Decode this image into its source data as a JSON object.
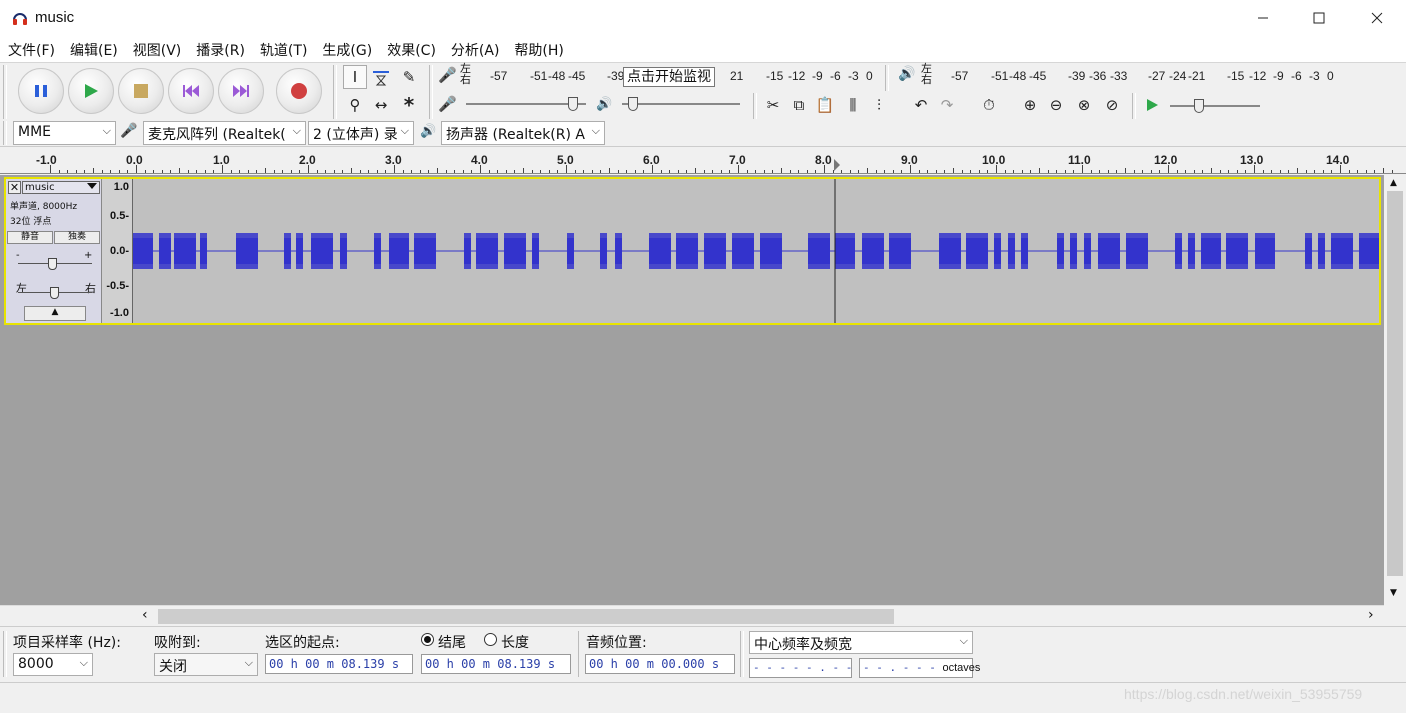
{
  "window": {
    "title": "music"
  },
  "menu": [
    "文件(F)",
    "编辑(E)",
    "视图(V)",
    "播录(R)",
    "轨道(T)",
    "生成(G)",
    "效果(C)",
    "分析(A)",
    "帮助(H)"
  ],
  "meters": {
    "rec_lr": [
      "左",
      "右"
    ],
    "rec_scale": [
      "-57",
      "-51",
      "-48",
      "-45",
      "-39",
      "21",
      "-15",
      "-12",
      "-9",
      "-6",
      "-3",
      "0"
    ],
    "monitor_tooltip": "点击开始监视",
    "play_lr": [
      "左",
      "右"
    ],
    "play_scale": [
      "-57",
      "-51",
      "-48",
      "-45",
      "-39",
      "-36",
      "-33",
      "-27",
      "-24",
      "-21",
      "-15",
      "-12",
      "-9",
      "-6",
      "-3",
      "0"
    ]
  },
  "device": {
    "host": "MME",
    "input": "麦克风阵列 (Realtek(",
    "channels": "2 (立体声) 录",
    "output": "扬声器 (Realtek(R) A"
  },
  "ruler": {
    "labels": [
      "-1.0",
      "0.0",
      "1.0",
      "2.0",
      "3.0",
      "4.0",
      "5.0",
      "6.0",
      "7.0",
      "8.0",
      "9.0",
      "10.0",
      "11.0",
      "12.0",
      "13.0",
      "14.0"
    ]
  },
  "track": {
    "name": "music",
    "info1": "单声道, 8000Hz",
    "info2": "32位 浮点",
    "mute": "静音",
    "solo": "独奏",
    "gain_minus": "-",
    "gain_plus": "+",
    "pan_left": "左",
    "pan_right": "右",
    "vscale": [
      "1.0",
      "0.5-",
      "0.0-",
      "-0.5-",
      "-1.0"
    ],
    "cursor_time_s": 8.139
  },
  "selection": {
    "rate_label": "项目采样率 (Hz):",
    "rate_value": "8000",
    "snap_label": "吸附到:",
    "snap_value": "关闭",
    "start_label": "选区的起点:",
    "end_label": "结尾",
    "length_label": "长度",
    "start_value": "00 h 00 m 08.139 s",
    "end_value": "00 h 00 m 08.139 s",
    "pos_label": "音频位置:",
    "pos_value": "00 h 00 m 00.000 s",
    "spectral_mode": "中心频率及频宽",
    "freq_value": "- - - - - . - -",
    "freq_unit": "Hz",
    "bw_value": "- - . - - -",
    "bw_unit": "octaves"
  },
  "status": {
    "watermark": "https://blog.csdn.net/weixin_53955759"
  },
  "colors": {
    "waveform": "#3333cc",
    "selected_border": "#e8e400",
    "track_bg": "#c0c0c0"
  }
}
